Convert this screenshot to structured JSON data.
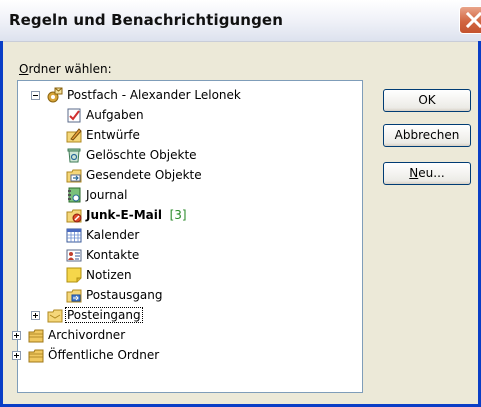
{
  "window": {
    "title": "Regeln und Benachrichtigungen"
  },
  "folder_label": {
    "accel": "O",
    "rest": "rdner wählen:"
  },
  "tree": {
    "root": {
      "label": "Postfach - Alexander Lelonek",
      "expanded": true
    },
    "children": [
      {
        "label": "Aufgaben",
        "icon": "tasks-icon"
      },
      {
        "label": "Entwürfe",
        "icon": "drafts-icon"
      },
      {
        "label": "Gelöschte Objekte",
        "icon": "deleted-items-icon"
      },
      {
        "label": "Gesendete Objekte",
        "icon": "sent-items-icon"
      },
      {
        "label": "Journal",
        "icon": "journal-icon"
      },
      {
        "label": "Junk-E-Mail",
        "badge": "[3]",
        "icon": "junk-mail-icon"
      },
      {
        "label": "Kalender",
        "icon": "calendar-icon"
      },
      {
        "label": "Kontakte",
        "icon": "contacts-icon"
      },
      {
        "label": "Notizen",
        "icon": "notes-icon"
      },
      {
        "label": "Postausgang",
        "icon": "outbox-icon"
      },
      {
        "label": "Posteingang",
        "icon": "inbox-icon",
        "selected": true
      }
    ],
    "others": [
      {
        "label": "Archivordner",
        "icon": "archive-folder-icon"
      },
      {
        "label": "Öffentliche Ordner",
        "icon": "public-folders-icon"
      }
    ]
  },
  "buttons": {
    "ok": "OK",
    "cancel": "Abbrechen",
    "new_accel": "N",
    "new_rest": "eu..."
  },
  "colors": {
    "frame": "#0a3ec6",
    "dialog_bg": "#ece9d8",
    "close": "#d26641",
    "badge": "#2a8a2a"
  }
}
